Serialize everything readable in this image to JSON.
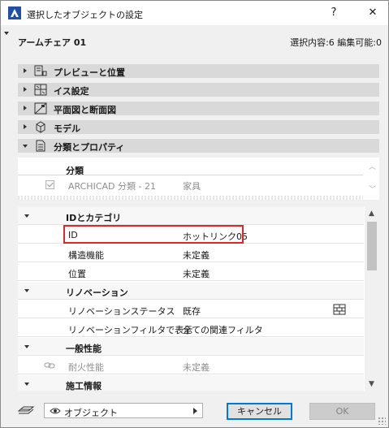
{
  "window": {
    "title": "選択したオブジェクトの設定",
    "help_glyph": "?",
    "close_glyph": "✕"
  },
  "header": {
    "object_name": "アームチェア 01",
    "selection_info": "選択内容:6 編集可能:0"
  },
  "sections": [
    {
      "label": "プレビューと位置",
      "icon": "preview-position-icon",
      "expanded": false
    },
    {
      "label": "イス設定",
      "icon": "chair-settings-icon",
      "expanded": false
    },
    {
      "label": "平面図と断面図",
      "icon": "floor-plan-section-icon",
      "expanded": false
    },
    {
      "label": "モデル",
      "icon": "model-cube-icon",
      "expanded": false
    },
    {
      "label": "分類とプロパティ",
      "icon": "document-icon",
      "expanded": true
    }
  ],
  "classification": {
    "header": "分類",
    "name": "ARCHICAD 分類 - 21",
    "value": "家具",
    "checked": true
  },
  "properties": {
    "groups": [
      {
        "name": "IDとカテゴリ",
        "rows": [
          {
            "name": "ID",
            "value": "ホットリンク05",
            "highlighted": true
          },
          {
            "name": "構造機能",
            "value": "未定義"
          },
          {
            "name": "位置",
            "value": "未定義"
          }
        ]
      },
      {
        "name": "リノベーション",
        "rows": [
          {
            "name": "リノベーションステータス",
            "value": "既存"
          },
          {
            "name": "リノベーションフィルタで表示",
            "value": "全ての関連フィルタ"
          }
        ]
      },
      {
        "name": "一般性能",
        "rows": [
          {
            "name": "耐火性能",
            "value": "未定義",
            "dim": true
          }
        ]
      },
      {
        "name": "施工情報",
        "rows": []
      }
    ]
  },
  "footer": {
    "view_selector": "オブジェクト",
    "cancel_label": "キャンセル",
    "ok_label": "OK"
  },
  "colors": {
    "accent": "#0078d7",
    "highlight_border": "#e0262a",
    "section_bg": "#d9d9d9"
  }
}
